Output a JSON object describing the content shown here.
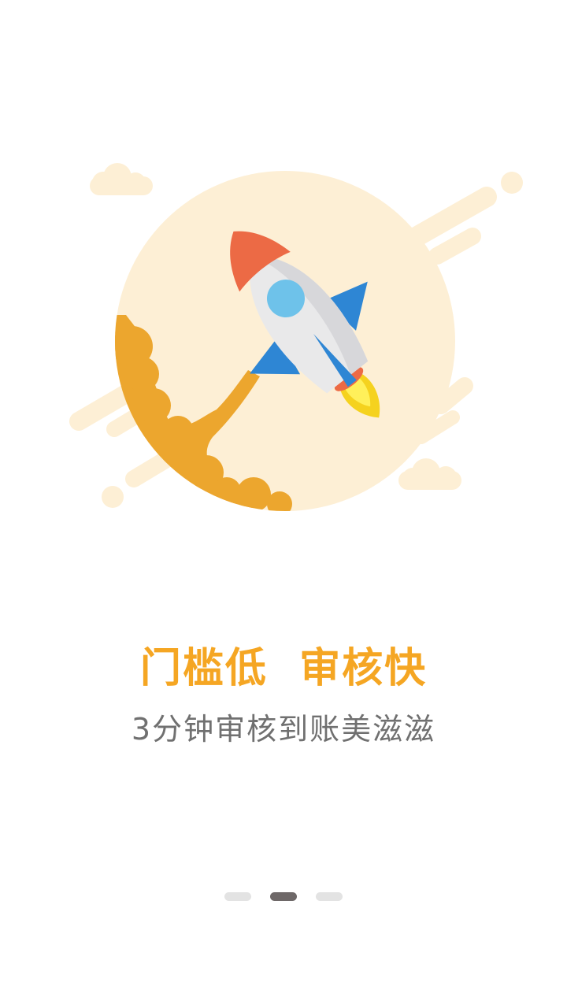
{
  "onboarding": {
    "title": "门槛低  审核快",
    "subtitle": "3分钟审核到账美滋滋",
    "illustration_icon": "rocket-icon",
    "page_count": 3,
    "active_page": 2
  },
  "colors": {
    "accent": "#f5a623",
    "circle": "#fdefd5",
    "smoke": "#eca62e",
    "rocket_nose": "#ec6a45",
    "rocket_fin": "#2e86d4",
    "rocket_window": "#6ec2ea",
    "indicator_active": "#6e6868",
    "indicator_inactive": "#e3e3e3"
  }
}
